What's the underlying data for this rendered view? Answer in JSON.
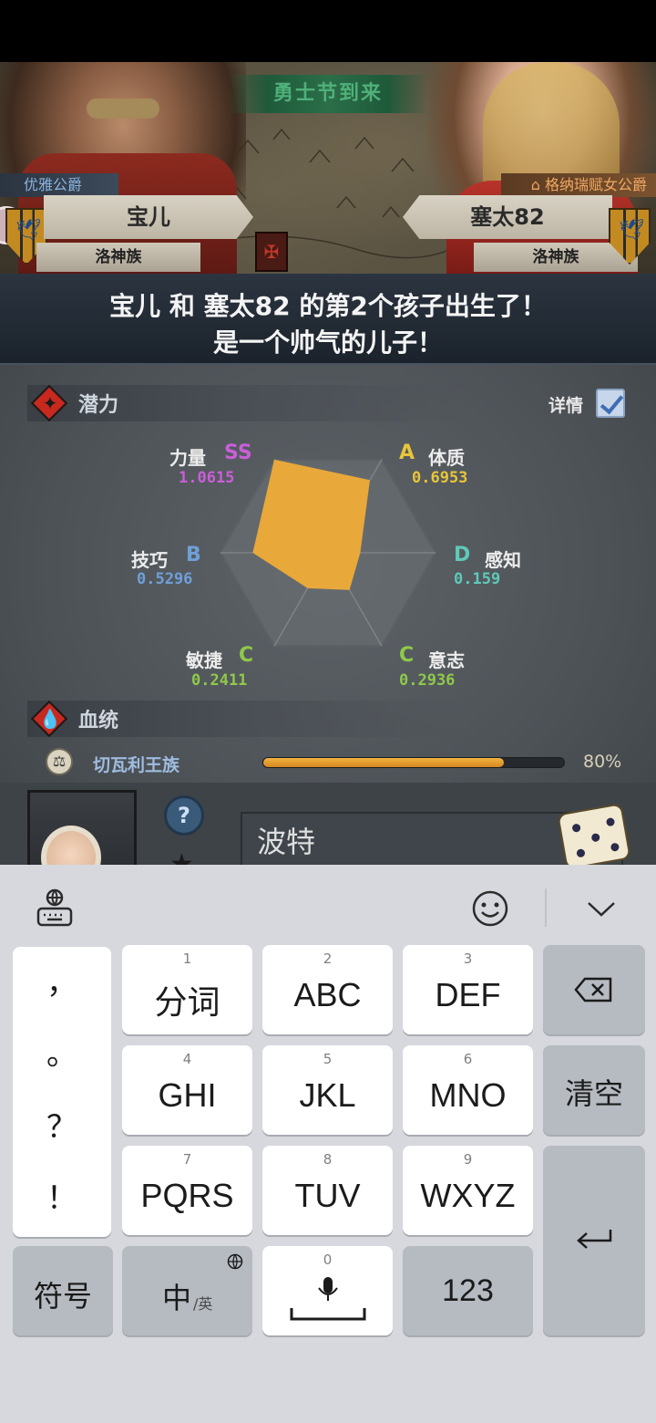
{
  "event_banner": "勇士节到来",
  "left_parent": {
    "title": "优雅公爵",
    "name": "宝儿",
    "clan": "洛神族"
  },
  "right_parent": {
    "title": "格纳瑞赋女公爵",
    "name": "塞太82",
    "clan": "洛神族"
  },
  "announcement": {
    "line1": "宝儿 和 塞太82 的第2个孩子出生了！",
    "line2": "是一个帅气的儿子！"
  },
  "potential": {
    "header": "潜力",
    "detail_label": "详情",
    "stats": [
      {
        "name": "力量",
        "grade": "SS",
        "value": "1.0615",
        "level": 1.0
      },
      {
        "name": "体质",
        "grade": "A",
        "value": "0.6953",
        "level": 0.78
      },
      {
        "name": "感知",
        "grade": "D",
        "value": "0.159",
        "level": 0.3
      },
      {
        "name": "意志",
        "grade": "C",
        "value": "0.2936",
        "level": 0.4
      },
      {
        "name": "敏捷",
        "grade": "C",
        "value": "0.2411",
        "level": 0.38
      },
      {
        "name": "技巧",
        "grade": "B",
        "value": "0.5296",
        "level": 0.7
      }
    ],
    "colors": {
      "SS": "#c95fd9",
      "A": "#e8c53a",
      "B": "#6fa0d8",
      "C": "#8fc94a",
      "D": "#5fc9b8",
      "radar_fill": "#e8a83a"
    }
  },
  "bloodline": {
    "header": "血统",
    "name": "切瓦利王族",
    "percent_label": "80%",
    "percent": 80
  },
  "child_name_input": {
    "value": "波特"
  },
  "keyboard": {
    "keys": [
      {
        "num": "1",
        "label": "分词"
      },
      {
        "num": "2",
        "label": "ABC"
      },
      {
        "num": "3",
        "label": "DEF"
      },
      {
        "num": "4",
        "label": "GHI"
      },
      {
        "num": "5",
        "label": "JKL"
      },
      {
        "num": "6",
        "label": "MNO"
      },
      {
        "num": "7",
        "label": "PQRS"
      },
      {
        "num": "8",
        "label": "TUV"
      },
      {
        "num": "9",
        "label": "WXYZ"
      }
    ],
    "punctuation": [
      "，",
      "。",
      "？",
      "！"
    ],
    "clear_label": "清空",
    "symbols_label": "符号",
    "lang_main": "中",
    "lang_sub": "/英",
    "space_num": "0",
    "numbers_label": "123",
    "icons": [
      "keyboard-settings-icon",
      "emoji-icon",
      "collapse-keyboard-icon",
      "backspace-icon",
      "enter-icon",
      "globe-icon",
      "microphone-icon"
    ]
  }
}
